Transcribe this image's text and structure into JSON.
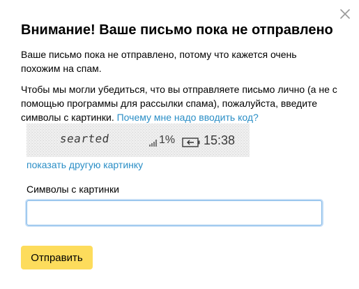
{
  "dialog": {
    "title": "Внимание! Ваше письмо пока не отправлено",
    "paragraph1": "Ваше письмо пока не отправлено, потому что кажется очень похожим на спам.",
    "paragraph2": "Чтобы мы могли убедиться, что вы отправляете письмо лично (а не с помощью программы для рассылки спама), пожалуйста, введите символы с картинки.",
    "why_link": "Почему мне надо вводить код?",
    "captcha": {
      "word": "searted",
      "signal_percent": "1%",
      "time": "15:38"
    },
    "other_picture_link": "показать другую картинку",
    "field_label": "Символы с картинки",
    "input_value": "",
    "submit_label": "Отправить",
    "close_icon": "close-icon"
  },
  "colors": {
    "link": "#2a8ec6",
    "button": "#fddc5c",
    "input_focus": "#7eb7e8"
  }
}
